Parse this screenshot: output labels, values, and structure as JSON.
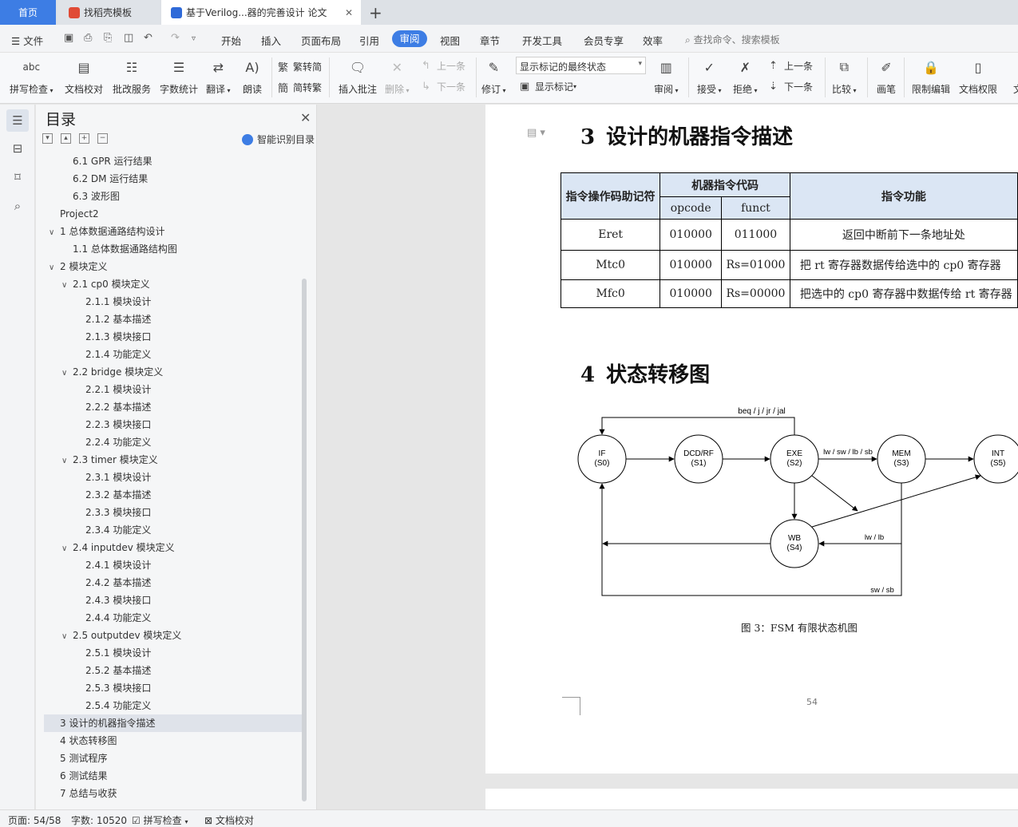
{
  "tabs": {
    "home": "首页",
    "template": "找稻壳模板",
    "document": "基于Verilog...器的完善设计 论文"
  },
  "menu": {
    "file": "文件",
    "items": [
      "开始",
      "插入",
      "页面布局",
      "引用",
      "审阅",
      "视图",
      "章节",
      "开发工具",
      "会员专享",
      "效率"
    ],
    "active": "审阅",
    "search_placeholder": "查找命令、搜索模板"
  },
  "ribbon": {
    "spell_check": "拼写检查",
    "doc_proof": "文档校对",
    "batch_service": "批改服务",
    "word_count": "字数统计",
    "translate": "翻译",
    "read_aloud": "朗读",
    "trad_to_simp": "繁转简",
    "simp_to_trad": "简转繁",
    "insert_comment": "插入批注",
    "delete": "删除",
    "prev_comment": "上一条",
    "next_comment": "下一条",
    "revise": "修订",
    "markup_state": "显示标记的最终状态",
    "show_markup": "显示标记",
    "review": "审阅",
    "accept": "接受",
    "reject": "拒绝",
    "prev_change": "上一条",
    "next_change": "下一条",
    "compare": "比较",
    "pen": "画笔",
    "restrict_edit": "限制编辑",
    "doc_permission": "文档权限",
    "doc_cut": "文"
  },
  "toc": {
    "title": "目录",
    "smart": "智能识别目录",
    "items": [
      {
        "text": "6.1 GPR 运行结果",
        "level": 2,
        "chev": ""
      },
      {
        "text": "6.2 DM 运行结果",
        "level": 2,
        "chev": ""
      },
      {
        "text": "6.3  波形图",
        "level": 2,
        "chev": ""
      },
      {
        "text": "Project2",
        "level": 1,
        "chev": ""
      },
      {
        "text": "1  总体数据通路结构设计",
        "level": 1,
        "chev": "v"
      },
      {
        "text": "1.1  总体数据通路结构图",
        "level": 2,
        "chev": ""
      },
      {
        "text": "2  模块定义",
        "level": 1,
        "chev": "v"
      },
      {
        "text": "2.1 cp0 模块定义",
        "level": 2,
        "chev": "v"
      },
      {
        "text": "2.1.1  模块设计",
        "level": 3,
        "chev": ""
      },
      {
        "text": "2.1.2  基本描述",
        "level": 3,
        "chev": ""
      },
      {
        "text": "2.1.3  模块接口",
        "level": 3,
        "chev": ""
      },
      {
        "text": "2.1.4  功能定义",
        "level": 3,
        "chev": ""
      },
      {
        "text": "2.2 bridge 模块定义",
        "level": 2,
        "chev": "v"
      },
      {
        "text": "2.2.1  模块设计",
        "level": 3,
        "chev": ""
      },
      {
        "text": "2.2.2  基本描述",
        "level": 3,
        "chev": ""
      },
      {
        "text": "2.2.3  模块接口",
        "level": 3,
        "chev": ""
      },
      {
        "text": "2.2.4  功能定义",
        "level": 3,
        "chev": ""
      },
      {
        "text": "2.3 timer 模块定义",
        "level": 2,
        "chev": "v"
      },
      {
        "text": "2.3.1  模块设计",
        "level": 3,
        "chev": ""
      },
      {
        "text": "2.3.2  基本描述",
        "level": 3,
        "chev": ""
      },
      {
        "text": "2.3.3  模块接口",
        "level": 3,
        "chev": ""
      },
      {
        "text": "2.3.4  功能定义",
        "level": 3,
        "chev": ""
      },
      {
        "text": "2.4 inputdev 模块定义",
        "level": 2,
        "chev": "v"
      },
      {
        "text": "2.4.1  模块设计",
        "level": 3,
        "chev": ""
      },
      {
        "text": "2.4.2  基本描述",
        "level": 3,
        "chev": ""
      },
      {
        "text": "2.4.3  模块接口",
        "level": 3,
        "chev": ""
      },
      {
        "text": "2.4.4  功能定义",
        "level": 3,
        "chev": ""
      },
      {
        "text": "2.5 outputdev 模块定义",
        "level": 2,
        "chev": "v"
      },
      {
        "text": "2.5.1  模块设计",
        "level": 3,
        "chev": ""
      },
      {
        "text": "2.5.2  基本描述",
        "level": 3,
        "chev": ""
      },
      {
        "text": "2.5.3  模块接口",
        "level": 3,
        "chev": ""
      },
      {
        "text": "2.5.4  功能定义",
        "level": 3,
        "chev": ""
      },
      {
        "text": "3  设计的机器指令描述",
        "level": 1,
        "chev": "",
        "selected": true
      },
      {
        "text": "4  状态转移图",
        "level": 1,
        "chev": ""
      },
      {
        "text": "5  测试程序",
        "level": 1,
        "chev": ""
      },
      {
        "text": "6  测试结果",
        "level": 1,
        "chev": ""
      },
      {
        "text": "7  总结与收获",
        "level": 1,
        "chev": ""
      }
    ]
  },
  "doc": {
    "section3": {
      "num": "3",
      "title": "设计的机器指令描述"
    },
    "section4": {
      "num": "4",
      "title": "状态转移图"
    },
    "table": {
      "h_mnemonic": "指令操作码助记符",
      "h_code": "机器指令代码",
      "h_opcode": "opcode",
      "h_funct": "funct",
      "h_function": "指令功能",
      "rows": [
        {
          "mnemonic": "Eret",
          "opcode": "010000",
          "funct": "011000",
          "desc": "返回中断前下一条地址处"
        },
        {
          "mnemonic": "Mtc0",
          "opcode": "010000",
          "funct": "Rs=01000",
          "desc": "把 rt 寄存器数据传给选中的 cp0 寄存器"
        },
        {
          "mnemonic": "Mfc0",
          "opcode": "010000",
          "funct": "Rs=00000",
          "desc": "把选中的 cp0 寄存器中数据传给 rt 寄存器"
        }
      ]
    },
    "fsm": {
      "states": [
        {
          "name": "IF",
          "code": "(S0)"
        },
        {
          "name": "DCD/RF",
          "code": "(S1)"
        },
        {
          "name": "EXE",
          "code": "(S2)"
        },
        {
          "name": "MEM",
          "code": "(S3)"
        },
        {
          "name": "INT",
          "code": "(S5)"
        },
        {
          "name": "WB",
          "code": "(S4)"
        }
      ],
      "labels": {
        "branch": "beq / j / jr / jal",
        "mem": "lw / sw / lb / sb",
        "load": "lw / lb",
        "store": "sw / sb"
      }
    },
    "caption": "图 3：FSM 有限状态机图",
    "page_number": "54"
  },
  "status": {
    "page": "页面: 54/58",
    "words": "字数: 10520",
    "spell": "拼写检查",
    "proof": "文档校对"
  }
}
